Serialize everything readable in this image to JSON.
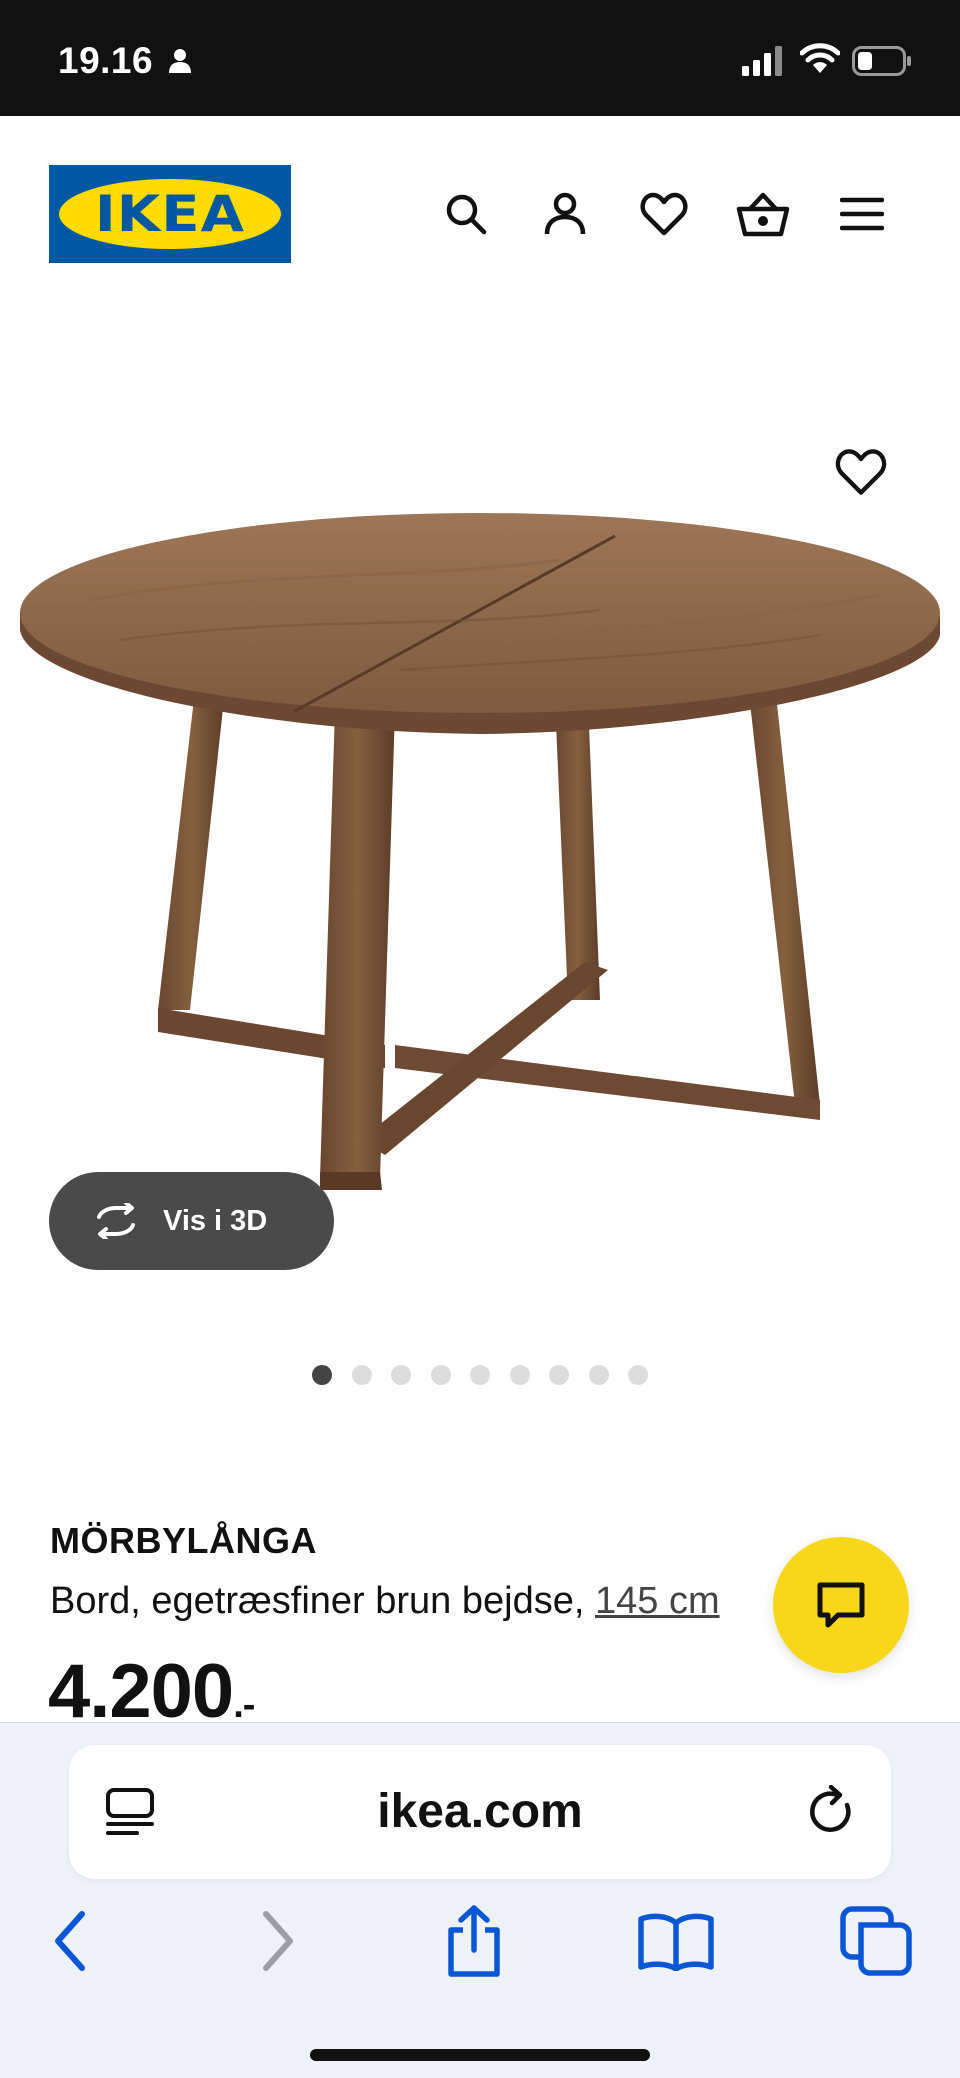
{
  "status_bar": {
    "time": "19.16"
  },
  "header": {
    "logo_text": "IKEA",
    "icons": [
      "search-icon",
      "user-icon",
      "heart-icon",
      "basket-icon",
      "menu-icon"
    ]
  },
  "product_gallery": {
    "view_3d_label": "Vis i 3D",
    "slide_count": 9,
    "active_slide": 1
  },
  "product": {
    "name": "MÖRBYLÅNGA",
    "description": "Bord, egetræsfiner brun bejdse,",
    "size_link": "145 cm",
    "price": "4.200",
    "price_suffix": ".-"
  },
  "browser": {
    "url": "ikea.com"
  },
  "colors": {
    "ikea_blue": "#0058a3",
    "ikea_yellow": "#ffdb00",
    "chat_yellow": "#f6d71a",
    "safari_blue": "#0a56d6"
  }
}
